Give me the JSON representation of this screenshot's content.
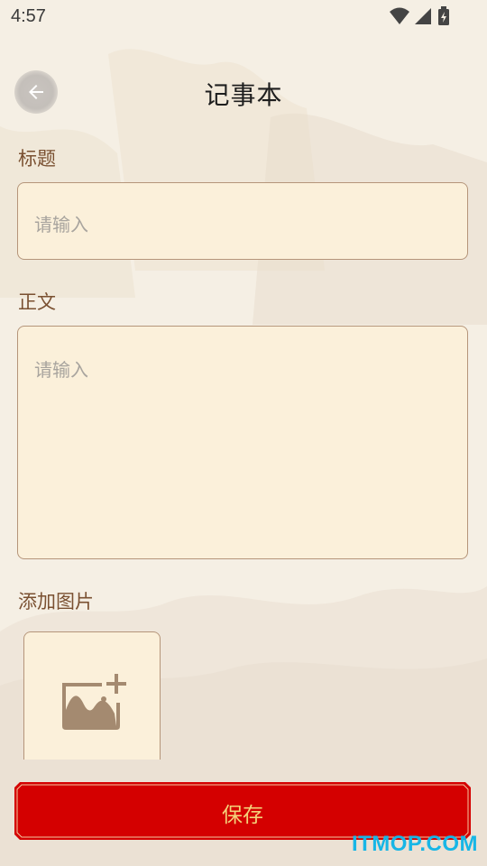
{
  "status_bar": {
    "time": "4:57",
    "icons": [
      "wifi-icon",
      "signal-icon",
      "battery-charging-icon"
    ]
  },
  "header": {
    "title": "记事本",
    "back_icon": "arrow-left-icon"
  },
  "form": {
    "title_label": "标题",
    "title_placeholder": "请输入",
    "body_label": "正文",
    "body_placeholder": "请输入",
    "image_label": "添加图片",
    "add_image_icon": "add-photo-icon"
  },
  "save_button": {
    "label": "保存"
  },
  "watermark": "ITMOP.COM",
  "colors": {
    "background": "#f5efe4",
    "input_fill": "#fbf0da",
    "input_border": "#b5957a",
    "label_text": "#7a5031",
    "button_red": "#d40000",
    "button_text": "#f4d27a",
    "watermark": "#17b6e6"
  }
}
